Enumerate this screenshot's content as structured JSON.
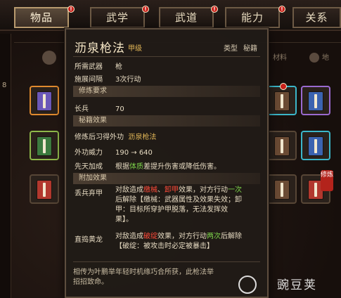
{
  "nav": {
    "tabs": [
      {
        "label": "物品",
        "active": true,
        "badge": "!"
      },
      {
        "label": "武学",
        "active": false,
        "badge": "!"
      },
      {
        "label": "武道",
        "active": false,
        "badge": "!"
      },
      {
        "label": "能力",
        "active": false,
        "badge": "!"
      },
      {
        "label": "关系",
        "active": false,
        "badge": ""
      }
    ]
  },
  "subtabs": [
    "材料",
    "地"
  ],
  "tooltip": {
    "title": "沥泉枪法",
    "grade": "甲级",
    "type_key": "类型",
    "type_value": "秘籍",
    "required_weapon_key": "所需武器",
    "required_weapon_value": "枪",
    "cooldown_key": "施展间隔",
    "cooldown_value": "3次行动",
    "section_requirements": "修炼要求",
    "req_key": "长兵",
    "req_value": "70",
    "section_effects": "秘籍效果",
    "learn_key": "修炼后习得外功",
    "learn_value": "沥泉枪法",
    "power_key": "外功威力",
    "power_value": "190 → 640",
    "innate_key": "先天加成",
    "innate_pre": "根据",
    "innate_attr": "体质",
    "innate_post": "差提升伤害或降低伤害。",
    "section_extra": "附加效果",
    "effect1_key": "丢兵弃甲",
    "effect1_line1_pre": "对敌造成",
    "effect1_line1_a": "缴械",
    "effect1_line1_sep": "、",
    "effect1_line1_b": "卸甲",
    "effect1_line1_mid": "效果，对方行动",
    "effect1_line1_num": "一次",
    "effect1_line2": "后解除【缴械：武器属性及效果失效；卸",
    "effect1_line3": "甲：目标所穿护甲脱落，无法发挥效",
    "effect1_line4": "果】。",
    "effect2_key": "直捣黄龙",
    "effect2_line1_pre": "对敌造成",
    "effect2_line1_a": "破绽",
    "effect2_line1_mid": "效果，对方行动",
    "effect2_line1_num": "两次",
    "effect2_line1_post": "后解除",
    "effect2_line2": "【破绽：被攻击时必定被暴击】",
    "description_line1": "相传为叶鹏举年轻时机缘巧合所获，此枪法举",
    "description_line2": "招招致命。"
  },
  "watermark": "豌豆荚",
  "colors": {
    "gold": "#e2b657",
    "green": "#7cd24a",
    "red": "#ff4b3a",
    "panel_bg": "#201b17",
    "panel_border": "#5d4d3e"
  },
  "left_strip_text": "8",
  "slot_badge_text": "修炼"
}
